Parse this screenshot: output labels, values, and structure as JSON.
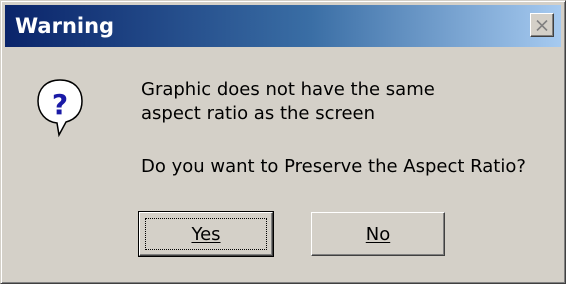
{
  "dialog": {
    "title": "Warning",
    "icon": "question-icon",
    "message_line1": "Graphic does not have the same",
    "message_line2": "aspect ratio as the screen",
    "question": "Do you want to Preserve the Aspect Ratio?",
    "buttons": {
      "yes_label": "Yes",
      "no_label": "No"
    },
    "close_icon": "close-icon"
  },
  "colors": {
    "title_gradient_start": "#0a246a",
    "title_gradient_end": "#a6caf0",
    "face": "#d4d0c8",
    "icon_blue": "#1a1aa6"
  }
}
